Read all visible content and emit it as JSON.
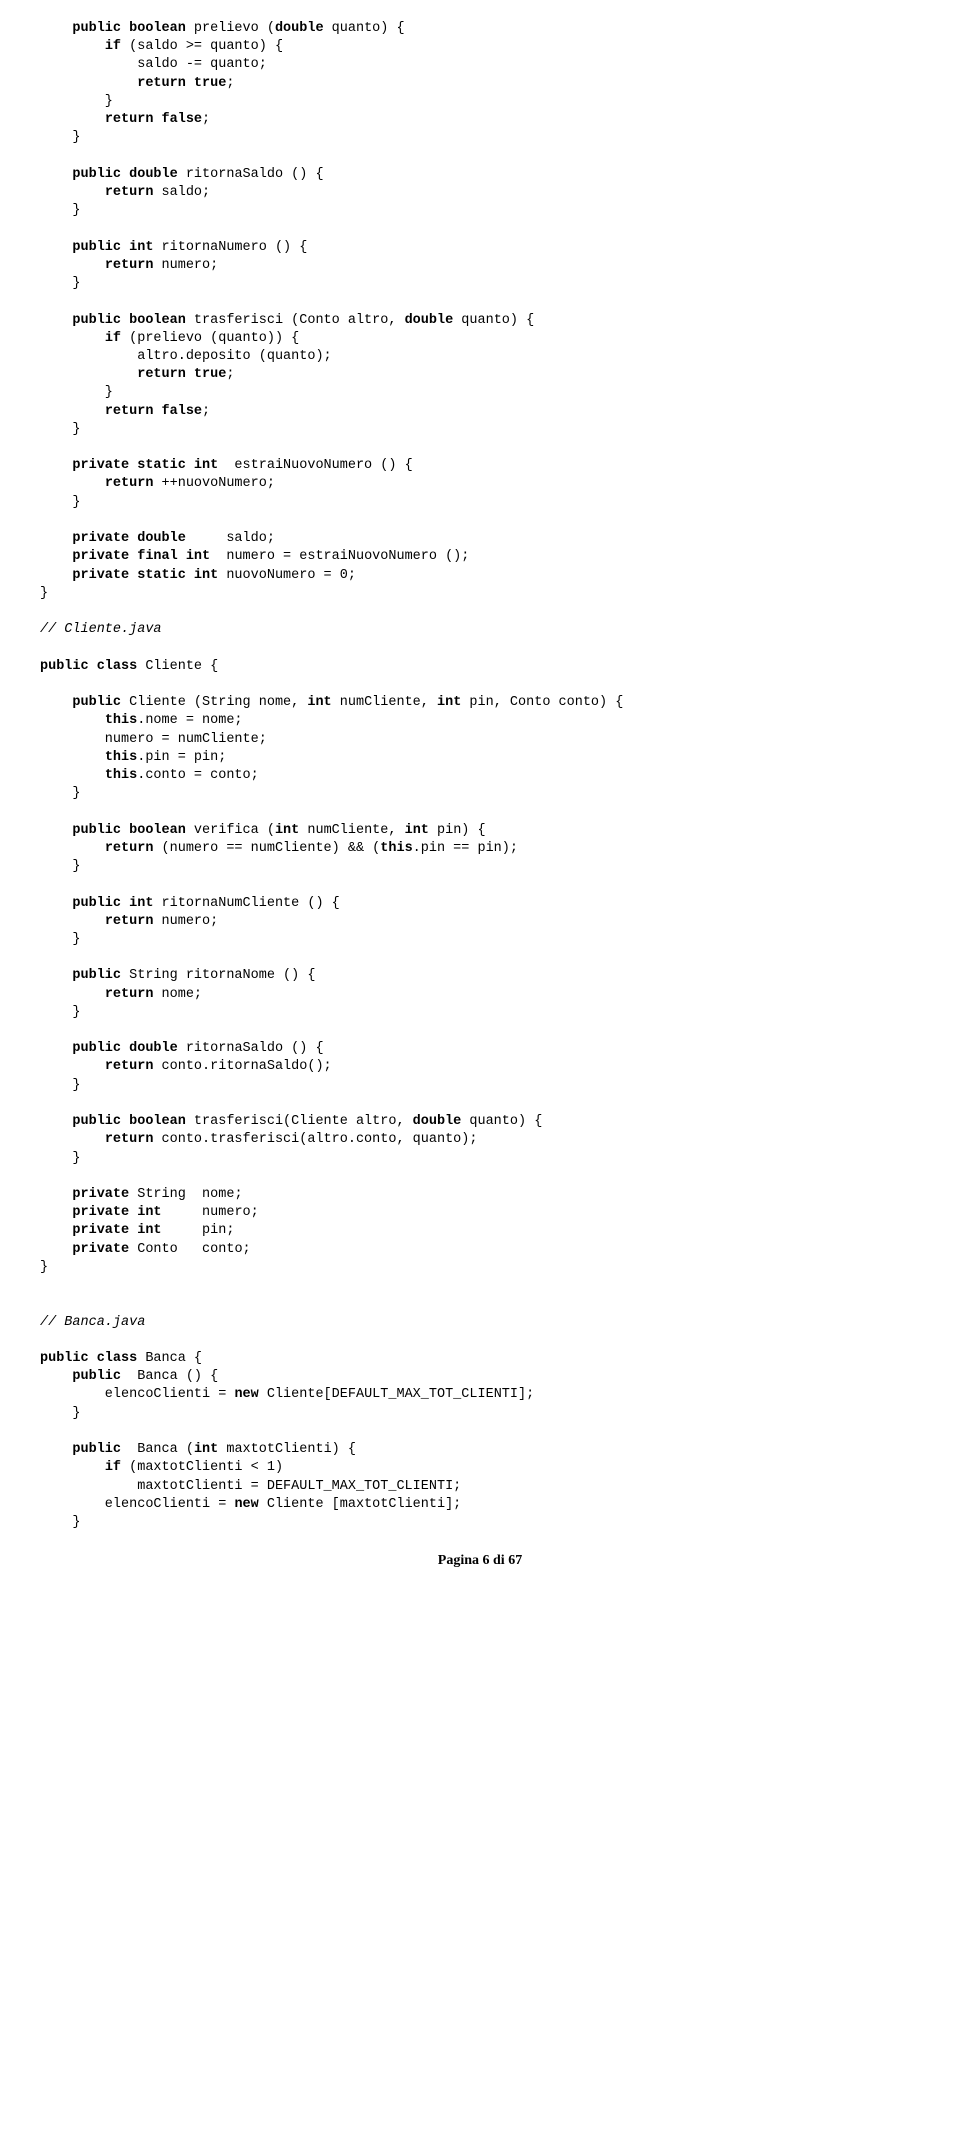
{
  "lines": [
    [
      4,
      [
        [
          "k",
          "public boolean"
        ],
        [
          "p",
          " prelievo "
        ],
        [
          "p",
          "("
        ],
        [
          "k",
          "double"
        ],
        [
          "p",
          " quanto) {"
        ]
      ]
    ],
    [
      8,
      [
        [
          "k",
          "if"
        ],
        [
          "p",
          " (saldo >= quanto) {"
        ]
      ]
    ],
    [
      12,
      [
        [
          "p",
          "saldo -= quanto"
        ],
        [
          "p",
          ";"
        ]
      ]
    ],
    [
      12,
      [
        [
          "k",
          "return true"
        ],
        [
          "p",
          ";"
        ]
      ]
    ],
    [
      8,
      [
        [
          "p",
          "}"
        ]
      ]
    ],
    [
      8,
      [
        [
          "k",
          "return false"
        ],
        [
          "p",
          ";"
        ]
      ]
    ],
    [
      4,
      [
        [
          "p",
          "}"
        ]
      ]
    ],
    [
      0,
      [
        [
          "p",
          ""
        ]
      ]
    ],
    [
      4,
      [
        [
          "k",
          "public double"
        ],
        [
          "p",
          " ritornaSaldo () {"
        ]
      ]
    ],
    [
      8,
      [
        [
          "k",
          "return"
        ],
        [
          "p",
          " saldo;"
        ]
      ]
    ],
    [
      4,
      [
        [
          "p",
          "}"
        ]
      ]
    ],
    [
      0,
      [
        [
          "p",
          ""
        ]
      ]
    ],
    [
      4,
      [
        [
          "k",
          "public int"
        ],
        [
          "p",
          " ritornaNumero () {"
        ]
      ]
    ],
    [
      8,
      [
        [
          "k",
          "return"
        ],
        [
          "p",
          " numero;"
        ]
      ]
    ],
    [
      4,
      [
        [
          "p",
          "}"
        ]
      ]
    ],
    [
      0,
      [
        [
          "p",
          ""
        ]
      ]
    ],
    [
      4,
      [
        [
          "k",
          "public boolean"
        ],
        [
          "p",
          " trasferisci (Conto altro, "
        ],
        [
          "k",
          "double"
        ],
        [
          "p",
          " quanto) {"
        ]
      ]
    ],
    [
      8,
      [
        [
          "k",
          "if"
        ],
        [
          "p",
          " (prelievo (quanto)) {"
        ]
      ]
    ],
    [
      12,
      [
        [
          "p",
          "altro.deposito (quanto);"
        ]
      ]
    ],
    [
      12,
      [
        [
          "k",
          "return true"
        ],
        [
          "p",
          ";"
        ]
      ]
    ],
    [
      8,
      [
        [
          "p",
          "}"
        ]
      ]
    ],
    [
      8,
      [
        [
          "k",
          "return false"
        ],
        [
          "p",
          ";"
        ]
      ]
    ],
    [
      4,
      [
        [
          "p",
          "}"
        ]
      ]
    ],
    [
      0,
      [
        [
          "p",
          ""
        ]
      ]
    ],
    [
      4,
      [
        [
          "k",
          "private static int"
        ],
        [
          "p",
          "  estraiNuovoNumero () {"
        ]
      ]
    ],
    [
      8,
      [
        [
          "k",
          "return"
        ],
        [
          "p",
          " ++nuovoNumero;"
        ]
      ]
    ],
    [
      4,
      [
        [
          "p",
          "}"
        ]
      ]
    ],
    [
      0,
      [
        [
          "p",
          ""
        ]
      ]
    ],
    [
      4,
      [
        [
          "k",
          "private double"
        ],
        [
          "p",
          "     saldo;"
        ]
      ]
    ],
    [
      4,
      [
        [
          "k",
          "private final int"
        ],
        [
          "p",
          "  numero = estraiNuovoNumero ();"
        ]
      ]
    ],
    [
      4,
      [
        [
          "k",
          "private static int"
        ],
        [
          "p",
          " nuovoNumero = 0;"
        ]
      ]
    ],
    [
      0,
      [
        [
          "p",
          "}"
        ]
      ]
    ],
    [
      0,
      [
        [
          "p",
          ""
        ]
      ]
    ],
    [
      0,
      [
        [
          "i",
          "// Cliente.java"
        ]
      ]
    ],
    [
      0,
      [
        [
          "p",
          ""
        ]
      ]
    ],
    [
      0,
      [
        [
          "k",
          "public class"
        ],
        [
          "p",
          " Cliente {"
        ]
      ]
    ],
    [
      0,
      [
        [
          "p",
          ""
        ]
      ]
    ],
    [
      4,
      [
        [
          "k",
          "public"
        ],
        [
          "p",
          " Cliente (String nome, "
        ],
        [
          "k",
          "int"
        ],
        [
          "p",
          " numCliente, "
        ],
        [
          "k",
          "int"
        ],
        [
          "p",
          " pin, Conto conto) {"
        ]
      ]
    ],
    [
      8,
      [
        [
          "k",
          "this"
        ],
        [
          "p",
          ".nome = nome;"
        ]
      ]
    ],
    [
      8,
      [
        [
          "p",
          "numero = numCliente;"
        ]
      ]
    ],
    [
      8,
      [
        [
          "k",
          "this"
        ],
        [
          "p",
          ".pin = pin;"
        ]
      ]
    ],
    [
      8,
      [
        [
          "k",
          "this"
        ],
        [
          "p",
          ".conto = conto;"
        ]
      ]
    ],
    [
      4,
      [
        [
          "p",
          "}"
        ]
      ]
    ],
    [
      0,
      [
        [
          "p",
          ""
        ]
      ]
    ],
    [
      4,
      [
        [
          "k",
          "public boolean"
        ],
        [
          "p",
          " verifica ("
        ],
        [
          "k",
          "int"
        ],
        [
          "p",
          " numCliente, "
        ],
        [
          "k",
          "int"
        ],
        [
          "p",
          " pin) {"
        ]
      ]
    ],
    [
      8,
      [
        [
          "k",
          "return"
        ],
        [
          "p",
          " (numero == numCliente) && ("
        ],
        [
          "k",
          "this"
        ],
        [
          "p",
          ".pin == pin);"
        ]
      ]
    ],
    [
      4,
      [
        [
          "p",
          "}"
        ]
      ]
    ],
    [
      0,
      [
        [
          "p",
          ""
        ]
      ]
    ],
    [
      4,
      [
        [
          "k",
          "public int"
        ],
        [
          "p",
          " ritornaNumCliente () {"
        ]
      ]
    ],
    [
      8,
      [
        [
          "k",
          "return"
        ],
        [
          "p",
          " numero;"
        ]
      ]
    ],
    [
      4,
      [
        [
          "p",
          "}"
        ]
      ]
    ],
    [
      0,
      [
        [
          "p",
          ""
        ]
      ]
    ],
    [
      4,
      [
        [
          "k",
          "public"
        ],
        [
          "p",
          " String ritornaNome () {"
        ]
      ]
    ],
    [
      8,
      [
        [
          "k",
          "return"
        ],
        [
          "p",
          " nome;"
        ]
      ]
    ],
    [
      4,
      [
        [
          "p",
          "}"
        ]
      ]
    ],
    [
      0,
      [
        [
          "p",
          ""
        ]
      ]
    ],
    [
      4,
      [
        [
          "k",
          "public double"
        ],
        [
          "p",
          " ritornaSaldo () {"
        ]
      ]
    ],
    [
      8,
      [
        [
          "k",
          "return"
        ],
        [
          "p",
          " conto.ritornaSaldo();"
        ]
      ]
    ],
    [
      4,
      [
        [
          "p",
          "}"
        ]
      ]
    ],
    [
      0,
      [
        [
          "p",
          ""
        ]
      ]
    ],
    [
      4,
      [
        [
          "k",
          "public boolean"
        ],
        [
          "p",
          " trasferisci(Cliente altro, "
        ],
        [
          "k",
          "double"
        ],
        [
          "p",
          " quanto) {"
        ]
      ]
    ],
    [
      8,
      [
        [
          "k",
          "return"
        ],
        [
          "p",
          " conto.trasferisci(altro.conto, quanto);"
        ]
      ]
    ],
    [
      4,
      [
        [
          "p",
          "}"
        ]
      ]
    ],
    [
      0,
      [
        [
          "p",
          ""
        ]
      ]
    ],
    [
      4,
      [
        [
          "k",
          "private"
        ],
        [
          "p",
          " String  nome;"
        ]
      ]
    ],
    [
      4,
      [
        [
          "k",
          "private int"
        ],
        [
          "p",
          "     numero;"
        ]
      ]
    ],
    [
      4,
      [
        [
          "k",
          "private int"
        ],
        [
          "p",
          "     pin;"
        ]
      ]
    ],
    [
      4,
      [
        [
          "k",
          "private"
        ],
        [
          "p",
          " Conto   conto;"
        ]
      ]
    ],
    [
      0,
      [
        [
          "p",
          "}"
        ]
      ]
    ],
    [
      0,
      [
        [
          "p",
          ""
        ]
      ]
    ],
    [
      0,
      [
        [
          "p",
          ""
        ]
      ]
    ],
    [
      0,
      [
        [
          "i",
          "// Banca.java"
        ]
      ]
    ],
    [
      0,
      [
        [
          "p",
          ""
        ]
      ]
    ],
    [
      0,
      [
        [
          "k",
          "public class"
        ],
        [
          "p",
          " Banca {"
        ]
      ]
    ],
    [
      4,
      [
        [
          "k",
          "public"
        ],
        [
          "p",
          "  Banca () {"
        ]
      ]
    ],
    [
      8,
      [
        [
          "p",
          "elencoClienti = "
        ],
        [
          "k",
          "new"
        ],
        [
          "p",
          " Cliente[DEFAULT_MAX_TOT_CLIENTI];"
        ]
      ]
    ],
    [
      4,
      [
        [
          "p",
          "}"
        ]
      ]
    ],
    [
      0,
      [
        [
          "p",
          ""
        ]
      ]
    ],
    [
      4,
      [
        [
          "k",
          "public"
        ],
        [
          "p",
          "  Banca ("
        ],
        [
          "k",
          "int"
        ],
        [
          "p",
          " maxtotClienti) {"
        ]
      ]
    ],
    [
      8,
      [
        [
          "k",
          "if"
        ],
        [
          "p",
          " (maxtotClienti < 1)"
        ]
      ]
    ],
    [
      12,
      [
        [
          "p",
          "maxtotClienti = DEFAULT_MAX_TOT_CLIENTI;"
        ]
      ]
    ],
    [
      8,
      [
        [
          "p",
          "elencoClienti = "
        ],
        [
          "k",
          "new"
        ],
        [
          "p",
          " Cliente [maxtotClienti];"
        ]
      ]
    ],
    [
      4,
      [
        [
          "p",
          "}"
        ]
      ]
    ]
  ],
  "footer": "Pagina 6 di 67"
}
